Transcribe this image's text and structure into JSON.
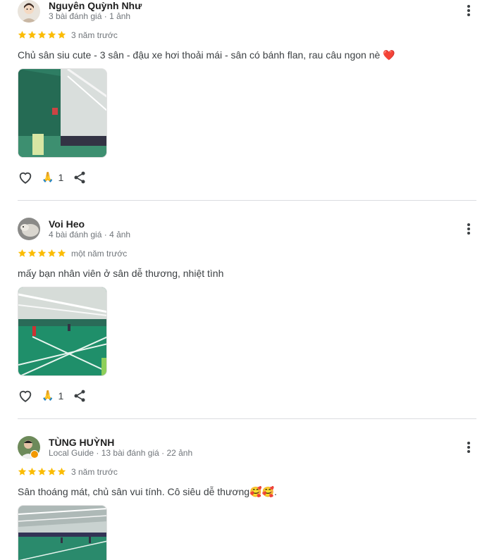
{
  "reviews": [
    {
      "name": "Nguyên Quỳnh Như",
      "meta": "3 bài đánh giá · 1 ảnh",
      "rating": 5,
      "time": "3 năm trước",
      "text": "Chủ sân siu cute - 3 sân - đậu xe hơi thoải mái - sân có bánh flan, rau câu ngon nè ❤️",
      "reaction_emoji": "🙏",
      "reaction_count": "1"
    },
    {
      "name": "Voi Heo",
      "meta": "4 bài đánh giá · 4 ảnh",
      "rating": 5,
      "time": "một năm trước",
      "text": "mấy bạn nhân viên ở sân dễ thương, nhiệt tình",
      "reaction_emoji": "🙏",
      "reaction_count": "1"
    },
    {
      "name": "TÙNG HUỲNH",
      "meta": "Local Guide · 13 bài đánh giá · 22 ảnh",
      "rating": 5,
      "time": "3 năm trước",
      "text": "Sân thoáng mát, chủ sân vui tính. Cô siêu dễ thương🥰🥰.",
      "reaction_emoji": "",
      "reaction_count": ""
    }
  ],
  "colors": {
    "star": "#fbbc04",
    "meta_text": "#70757a",
    "court_green": "#1f8f6a",
    "divider": "#dadce0",
    "local_guide_badge": "#f29900"
  },
  "icons": {
    "like": "heart-outline-icon",
    "share": "share-icon",
    "more": "more-vert-icon",
    "star": "star-icon"
  }
}
